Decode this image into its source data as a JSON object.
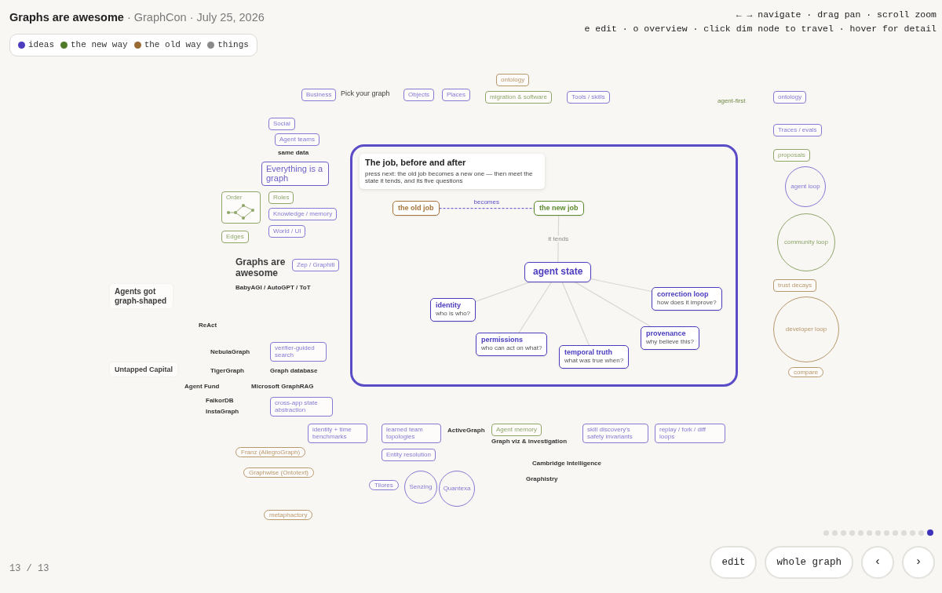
{
  "header": {
    "title": "Graphs are awesome",
    "meta": "· GraphCon · July 25, 2026"
  },
  "legend": [
    {
      "label": "ideas",
      "color": "#4a3bbf"
    },
    {
      "label": "the new way",
      "color": "#4f7a28"
    },
    {
      "label": "the old way",
      "color": "#9a6a34"
    },
    {
      "label": "things",
      "color": "#8a8a8a"
    }
  ],
  "hints": [
    "← → navigate · drag pan · scroll zoom",
    "e edit · o overview · click dim node to travel · hover for detail"
  ],
  "canvas": {
    "top_row": [
      {
        "kind": "card",
        "title": "ontology",
        "color": "#b8976b"
      },
      {
        "kind": "card",
        "title": "Business",
        "color": "#8479d3"
      },
      {
        "kind": "heading",
        "title": "Pick your graph"
      },
      {
        "kind": "card",
        "title": "Objects",
        "color": "#8479d3"
      },
      {
        "kind": "card",
        "title": "Places",
        "color": "#8479d3"
      },
      {
        "kind": "card",
        "title": "migration & software",
        "color": "#8fa66a"
      },
      {
        "kind": "card",
        "title": "Tools / skills",
        "color": "#8479d3"
      }
    ],
    "right_column": [
      {
        "kind": "note",
        "title": "agent-first"
      },
      {
        "kind": "card",
        "title": "ontology",
        "color": "#8479d3"
      },
      {
        "kind": "card",
        "title": "Traces / evals",
        "color": "#8479d3"
      },
      {
        "kind": "card",
        "title": "proposals",
        "color": "#8fa66a"
      },
      {
        "kind": "circle",
        "title": "agent loop",
        "color": "#8479d3"
      },
      {
        "kind": "circle",
        "title": "community loop",
        "color": "#8fa66a"
      },
      {
        "kind": "card",
        "title": "trust decays",
        "color": "#b8976b"
      },
      {
        "kind": "circle",
        "title": "developer loop",
        "color": "#b8976b"
      },
      {
        "kind": "pill",
        "title": "compare",
        "color": "#b8976b"
      }
    ],
    "left_cluster": [
      {
        "kind": "card",
        "title": "Social",
        "color": "#8479d3"
      },
      {
        "kind": "card",
        "title": "Agent teams",
        "color": "#8479d3"
      },
      {
        "kind": "label",
        "title": "same data"
      },
      {
        "kind": "title_card",
        "title": "Everything is a graph",
        "color": "#6a5ec8"
      },
      {
        "kind": "figure_card",
        "title": "Order",
        "color": "#8fa66a"
      },
      {
        "kind": "card",
        "title": "Roles",
        "color": "#8fa66a"
      },
      {
        "kind": "card",
        "title": "Knowledge / memory",
        "color": "#8479d3"
      },
      {
        "kind": "card",
        "title": "Edges",
        "color": "#8fa66a"
      },
      {
        "kind": "card",
        "title": "World / UI",
        "color": "#8479d3"
      },
      {
        "kind": "heading",
        "title": "Graphs are awesome"
      },
      {
        "kind": "card",
        "title": "Zep / Graphiti",
        "color": "#8479d3"
      },
      {
        "kind": "plain_card",
        "title": "Agents got graph-shaped"
      },
      {
        "kind": "label",
        "title": "BabyAGI / AutoGPT / ToT"
      },
      {
        "kind": "label",
        "title": "ReAct"
      },
      {
        "kind": "label",
        "title": "NebulaGraph"
      },
      {
        "kind": "card",
        "title": "verifier-guided search",
        "color": "#8479d3"
      },
      {
        "kind": "plain_card",
        "title": "Untapped Capital"
      },
      {
        "kind": "label",
        "title": "TigerGraph"
      },
      {
        "kind": "label",
        "title": "Graph database"
      },
      {
        "kind": "label",
        "title": "Agent Fund"
      },
      {
        "kind": "label",
        "title": "Microsoft GraphRAG"
      },
      {
        "kind": "label",
        "title": "FalkorDB"
      },
      {
        "kind": "label",
        "title": "InstaGraph"
      },
      {
        "kind": "card",
        "title": "cross-app state abstraction",
        "color": "#8479d3"
      }
    ],
    "bottom_row": [
      {
        "kind": "card",
        "title": "identity + time benchmarks",
        "color": "#8479d3"
      },
      {
        "kind": "card",
        "title": "learned team topologies",
        "color": "#8479d3"
      },
      {
        "kind": "label",
        "title": "ActiveGraph"
      },
      {
        "kind": "card",
        "title": "Agent memory",
        "color": "#8fa66a"
      },
      {
        "kind": "label",
        "title": "Graph viz & investigation"
      },
      {
        "kind": "card",
        "title": "skill discovery's safety invariants",
        "color": "#8479d3"
      },
      {
        "kind": "card",
        "title": "replay / fork / diff loops",
        "color": "#8479d3"
      },
      {
        "kind": "pill",
        "title": "Franz (AllegroGraph)",
        "color": "#b8976b"
      },
      {
        "kind": "card",
        "title": "Entity resolution",
        "color": "#8479d3"
      },
      {
        "kind": "label",
        "title": "Cambridge Intelligence"
      },
      {
        "kind": "pill",
        "title": "Graphwise (Ontotext)",
        "color": "#b8976b"
      },
      {
        "kind": "pill",
        "title": "Tilores",
        "color": "#8479d3"
      },
      {
        "kind": "circle",
        "title": "Senzing",
        "color": "#8479d3"
      },
      {
        "kind": "circle",
        "title": "Quantexa",
        "color": "#8479d3"
      },
      {
        "kind": "label",
        "title": "Graphistry"
      },
      {
        "kind": "pill",
        "title": "metaphactory",
        "color": "#b8976b"
      }
    ]
  },
  "focus_frame": {
    "nodes": [
      {
        "kind": "intro",
        "title": "The job, before and after",
        "subtitle": "press next: the old job becomes a new one — then meet the state it tends, and its five questions"
      },
      {
        "kind": "card",
        "title": "the old job",
        "color": "#a5743a"
      },
      {
        "kind": "card",
        "title": "the new job",
        "color": "#5a8a2a"
      },
      {
        "kind": "hub",
        "title": "agent state",
        "color": "#4a3bbf"
      },
      {
        "kind": "card",
        "title": "identity",
        "subtitle": "who is who?",
        "color": "#4a3bbf"
      },
      {
        "kind": "card",
        "title": "correction loop",
        "subtitle": "how does it improve?",
        "color": "#4a3bbf"
      },
      {
        "kind": "card",
        "title": "permissions",
        "subtitle": "who can act on what?",
        "color": "#4a3bbf"
      },
      {
        "kind": "card",
        "title": "temporal truth",
        "subtitle": "what was true when?",
        "color": "#4a3bbf"
      },
      {
        "kind": "card",
        "title": "provenance",
        "subtitle": "why believe this?",
        "color": "#4a3bbf"
      }
    ],
    "edges": [
      {
        "kind": "dashed",
        "label": "becomes"
      },
      {
        "kind": "solid",
        "label": "it tends"
      },
      {
        "kind": "solid"
      },
      {
        "kind": "solid"
      },
      {
        "kind": "solid"
      },
      {
        "kind": "solid"
      },
      {
        "kind": "solid"
      }
    ]
  },
  "pager": {
    "counter": "13 / 13",
    "pages": [
      {
        "selected": false
      },
      {
        "selected": false
      },
      {
        "selected": false
      },
      {
        "selected": false
      },
      {
        "selected": false
      },
      {
        "selected": false
      },
      {
        "selected": false
      },
      {
        "selected": false
      },
      {
        "selected": false
      },
      {
        "selected": false
      },
      {
        "selected": false
      },
      {
        "selected": false
      },
      {
        "selected": true
      }
    ]
  },
  "buttons": [
    {
      "label": "edit",
      "kind": "text"
    },
    {
      "label": "whole graph",
      "kind": "text"
    },
    {
      "label": "‹",
      "kind": "arrow"
    },
    {
      "label": "›",
      "kind": "arrow"
    }
  ]
}
